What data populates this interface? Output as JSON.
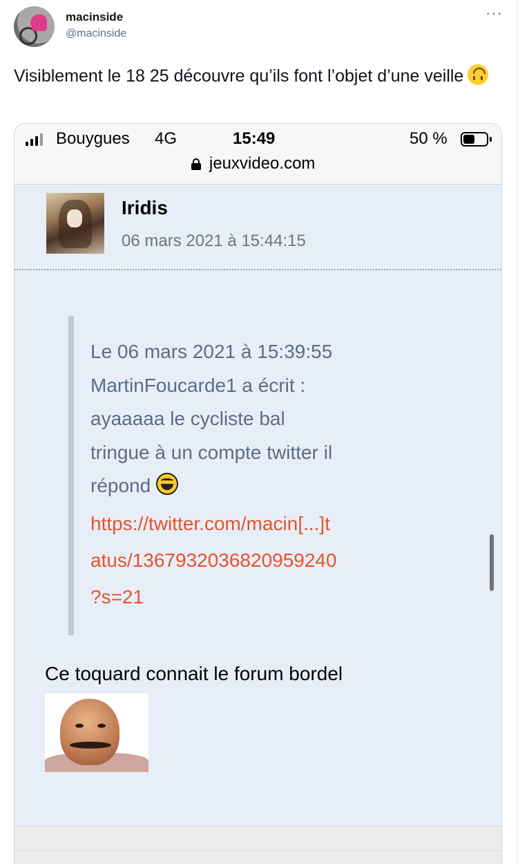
{
  "tweet": {
    "display_name": "macinside",
    "handle": "@macinside",
    "more_label": "···",
    "text": "Visiblement le 18 25 découvre qu’ils font l’objet d’une veille",
    "emoji": "upside-down-face"
  },
  "screenshot": {
    "status_bar": {
      "carrier": "Bouygues",
      "network": "4G",
      "time": "15:49",
      "battery_percent": "50 %",
      "battery_level": 0.5
    },
    "address_bar": {
      "url": "jeuxvideo.com",
      "icon": "lock-icon"
    },
    "post": {
      "author": "Iridis",
      "date": "06 mars 2021 à 15:44:15",
      "quote": {
        "lines": [
          "Le 06 mars 2021 à 15:39:55",
          "MartinFoucarde1 a écrit :",
          "ayaaaaa le cycliste bal",
          "tringue à un compte twitter il",
          "répond"
        ],
        "emoji": "laughing-smiley",
        "link_lines": [
          "https://twitter.com/macin[...]t",
          "atus/1367932036820959240",
          "?s=21"
        ]
      },
      "reply_text": "Ce toquard connait le forum bordel",
      "sticker": "mustache-man-sticker"
    }
  },
  "colors": {
    "post_background": "#e8eef7",
    "quote_text": "#5a6d85",
    "link": "#e5532d",
    "handle": "#5b7083"
  }
}
